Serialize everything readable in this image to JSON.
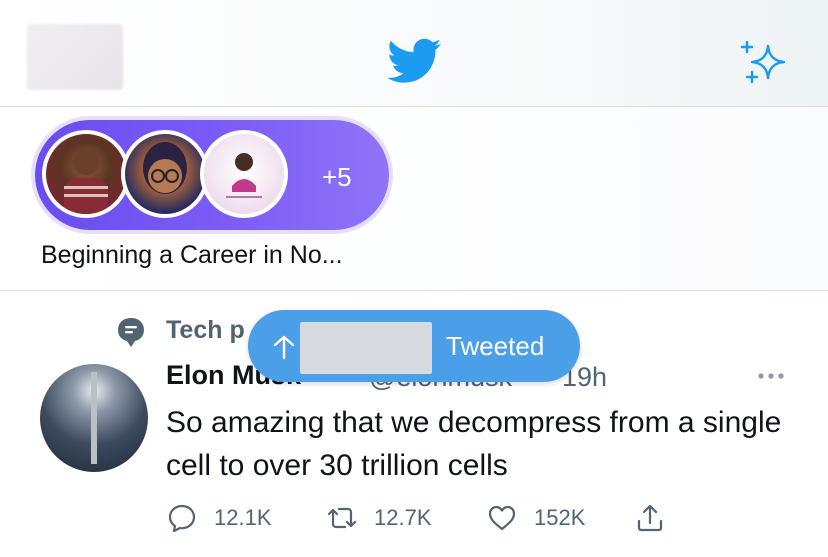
{
  "header": {
    "logo_icon": "twitter-bird-icon",
    "sparkle_icon": "sparkle-icon",
    "accent_color": "#1d9bf0"
  },
  "spaces": {
    "extra_count": "+5",
    "title": "Beginning a Career in No...",
    "pill_color": "#7358f2"
  },
  "new_tweets": {
    "label": "Tweeted",
    "arrow_icon": "arrow-up-icon"
  },
  "tweet": {
    "topic": "Tech p",
    "topic_icon": "topic-icon",
    "author": "Elon Musk",
    "handle": "@elonmusk",
    "time": "19h",
    "text": "So amazing that we decompress from a single cell to over 30 trillion cells",
    "actions": {
      "reply_count": "12.1K",
      "retweet_count": "12.7K",
      "like_count": "152K"
    }
  }
}
